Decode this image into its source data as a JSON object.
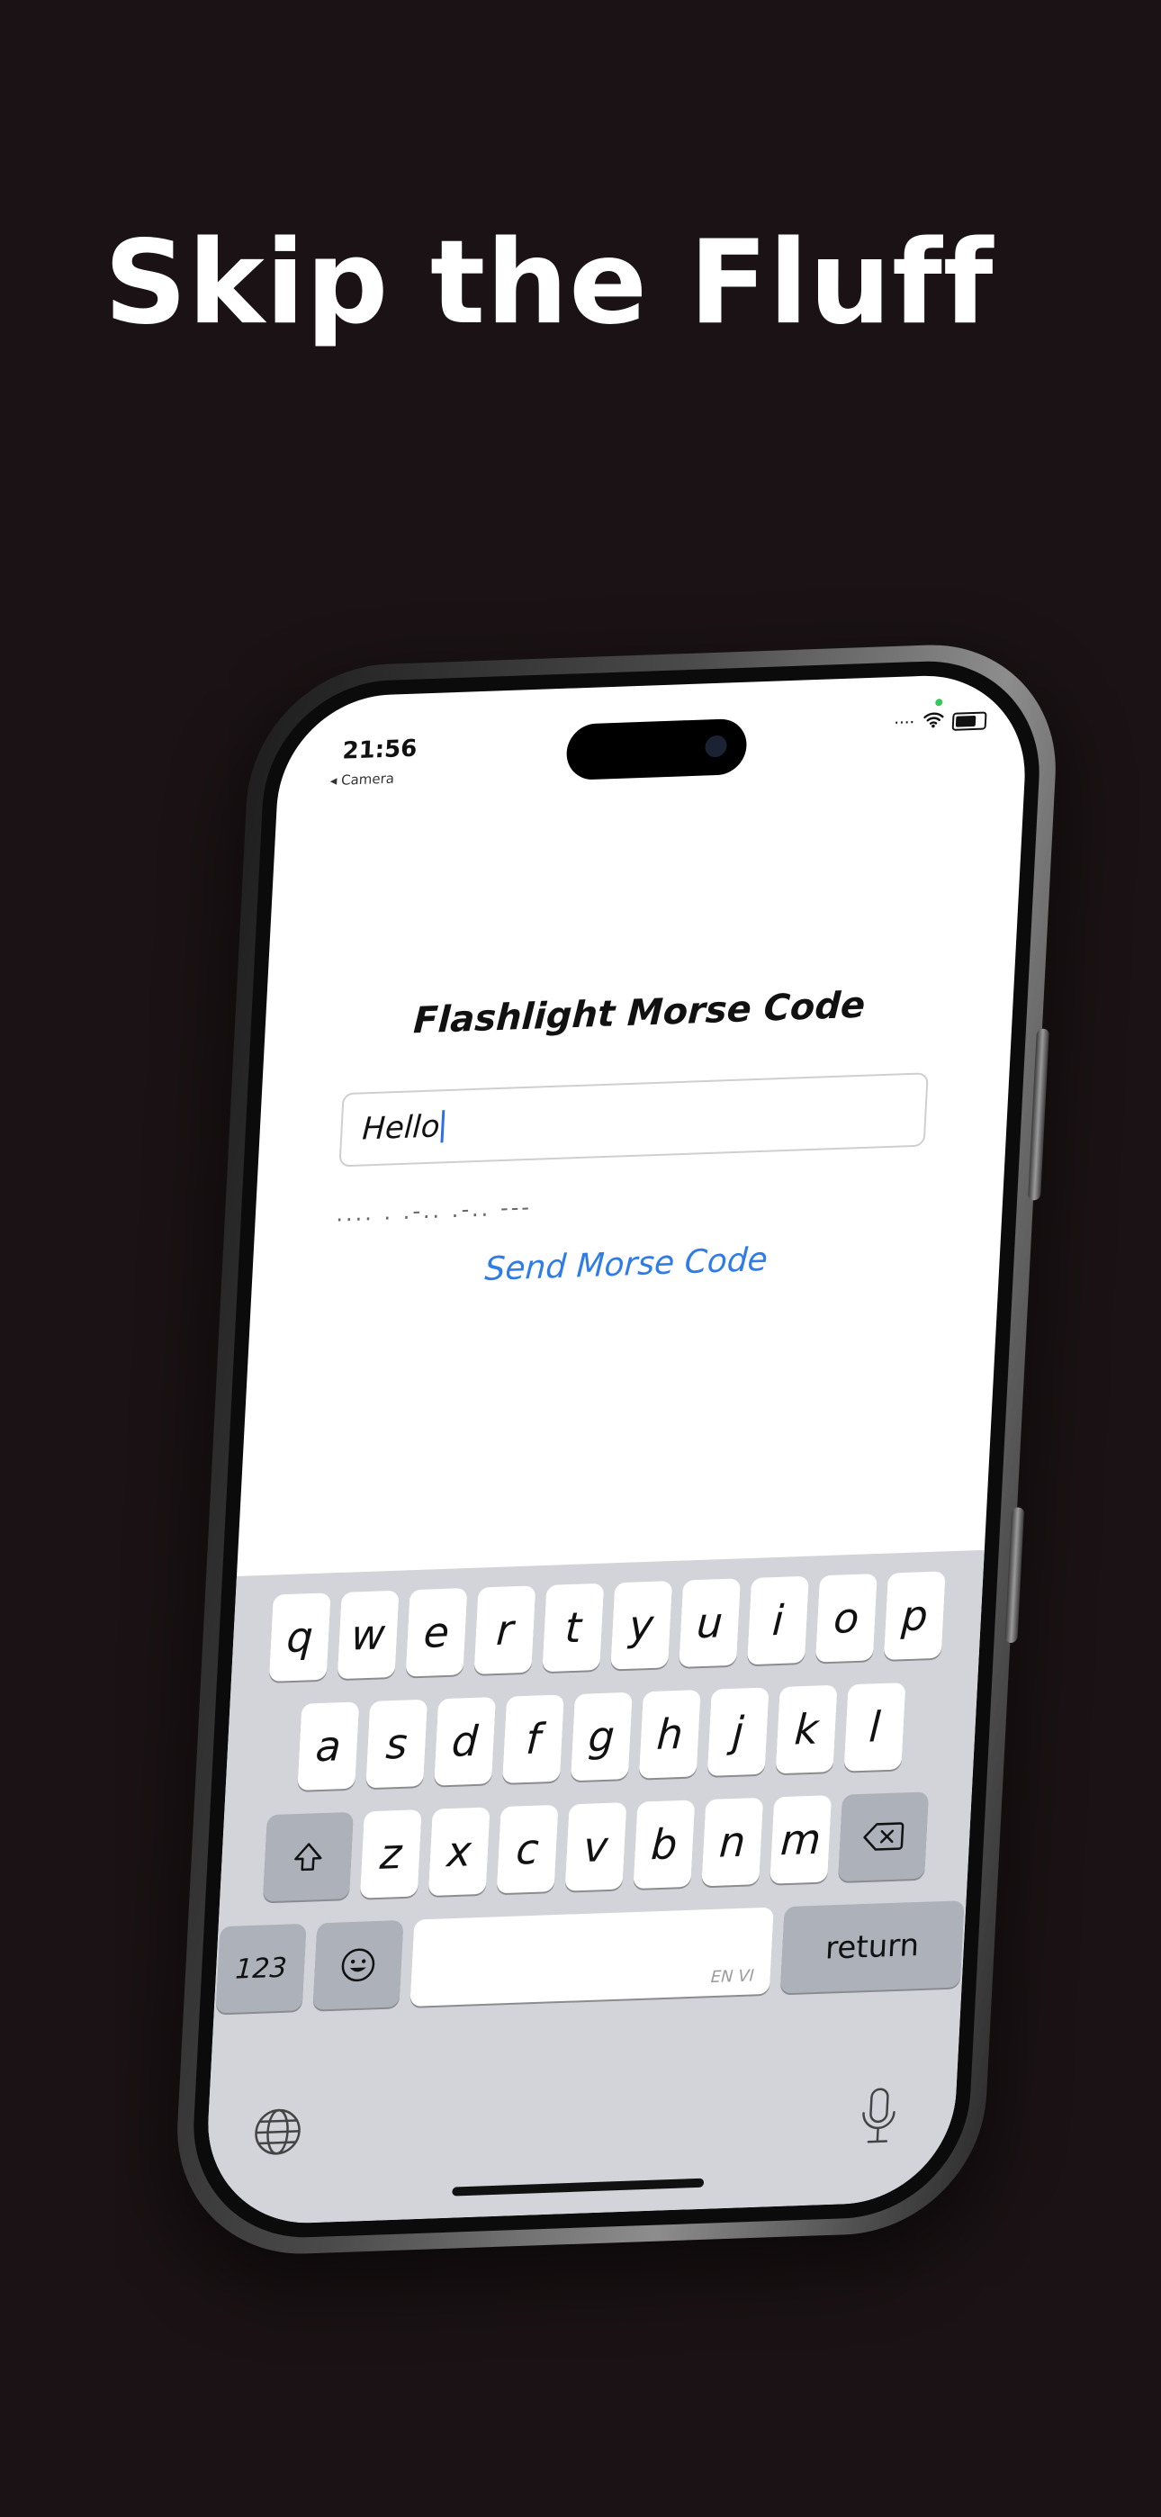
{
  "headline": "Skip the Fluff",
  "status_bar": {
    "time": "21:56",
    "back_label": "◂ Camera"
  },
  "app": {
    "title": "Flashlight Morse Code",
    "input_value": "Hello",
    "morse_output": ".... . .-.. .-.. ---",
    "send_button_label": "Send Morse Code"
  },
  "keyboard": {
    "row1": [
      "q",
      "w",
      "e",
      "r",
      "t",
      "y",
      "u",
      "i",
      "o",
      "p"
    ],
    "row2": [
      "a",
      "s",
      "d",
      "f",
      "g",
      "h",
      "j",
      "k",
      "l"
    ],
    "row3": [
      "z",
      "x",
      "c",
      "v",
      "b",
      "n",
      "m"
    ],
    "numbers_key": "123",
    "space_lang_label": "EN VI",
    "return_key": "return"
  },
  "colors": {
    "background": "#1a1214",
    "accent_link": "#2f7ce8",
    "keyboard_bg": "#d2d4d9"
  }
}
